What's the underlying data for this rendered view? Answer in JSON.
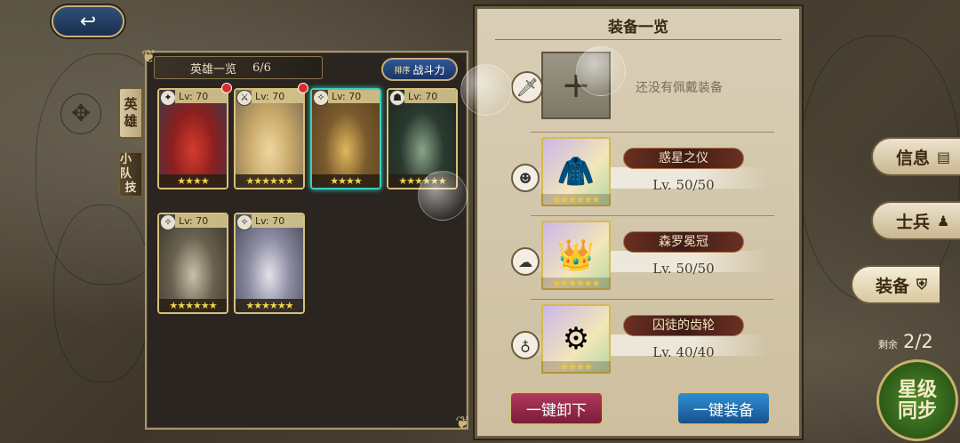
{
  "back_button": {
    "icon": "↩"
  },
  "hero_panel": {
    "title": "英雄一览",
    "count": "6/6",
    "sort": {
      "prefix": "排序",
      "label": "战斗力"
    },
    "tabs": [
      {
        "label_top": "英",
        "label_bottom": "雄"
      },
      {
        "label_top": "小队",
        "label_bottom": "技"
      }
    ],
    "heroes": [
      {
        "level": "Lv: 70",
        "stars": "★★★★",
        "class_icon": "✦",
        "notify": true,
        "selected": false,
        "palette": [
          "#8c1f1f",
          "#d43c2e",
          "#3c3c4a"
        ]
      },
      {
        "level": "Lv: 70",
        "stars": "★★★★★★",
        "class_icon": "⚔",
        "notify": true,
        "selected": false,
        "palette": [
          "#c9a96a",
          "#efd7a0",
          "#7a6a52"
        ]
      },
      {
        "level": "Lv: 70",
        "stars": "★★★★",
        "class_icon": "✧",
        "notify": false,
        "selected": true,
        "palette": [
          "#7a5a2e",
          "#e0b75c",
          "#5a3f1e"
        ]
      },
      {
        "level": "Lv: 70",
        "stars": "★★★★★★",
        "class_icon": "☗",
        "notify": false,
        "selected": false,
        "palette": [
          "#2a3a30",
          "#8aa48a",
          "#1c2620"
        ]
      },
      {
        "level": "Lv: 70",
        "stars": "★★★★★★",
        "class_icon": "✧",
        "notify": false,
        "selected": false,
        "palette": [
          "#6a6250",
          "#c8c0a6",
          "#3a342a"
        ]
      },
      {
        "level": "Lv: 70",
        "stars": "★★★★★★",
        "class_icon": "✧",
        "notify": false,
        "selected": false,
        "palette": [
          "#8a8aa0",
          "#e4e2ea",
          "#4a4a5a"
        ]
      }
    ]
  },
  "equip_panel": {
    "title": "装备一览",
    "empty_text": "还没有佩戴装备",
    "empty_plus": "+",
    "weapon_icon": "🗡",
    "items": [
      {
        "name": "惑星之仪",
        "level": "Lv. 50/50",
        "stars": "★★★★★★",
        "icon": "🧥",
        "slot_icon": "☻"
      },
      {
        "name": "森罗冕冠",
        "level": "Lv. 50/50",
        "stars": "★★★★★★",
        "icon": "👑",
        "slot_icon": "☁"
      },
      {
        "name": "囚徒的齿轮",
        "level": "Lv. 40/40",
        "stars": "★★★★",
        "icon": "⚙",
        "slot_icon": "♁"
      }
    ],
    "unequip_all": "一键卸下",
    "equip_all": "一键装备"
  },
  "side_menu": [
    {
      "label": "信息",
      "icon": "▤",
      "active": false
    },
    {
      "label": "士兵",
      "icon": "♟",
      "active": false
    },
    {
      "label": "装备",
      "icon": "⛨",
      "active": true
    }
  ],
  "remaining": {
    "label": "剩余",
    "value": "2/2"
  },
  "star_sync": {
    "line1": "星级",
    "line2": "同步"
  }
}
